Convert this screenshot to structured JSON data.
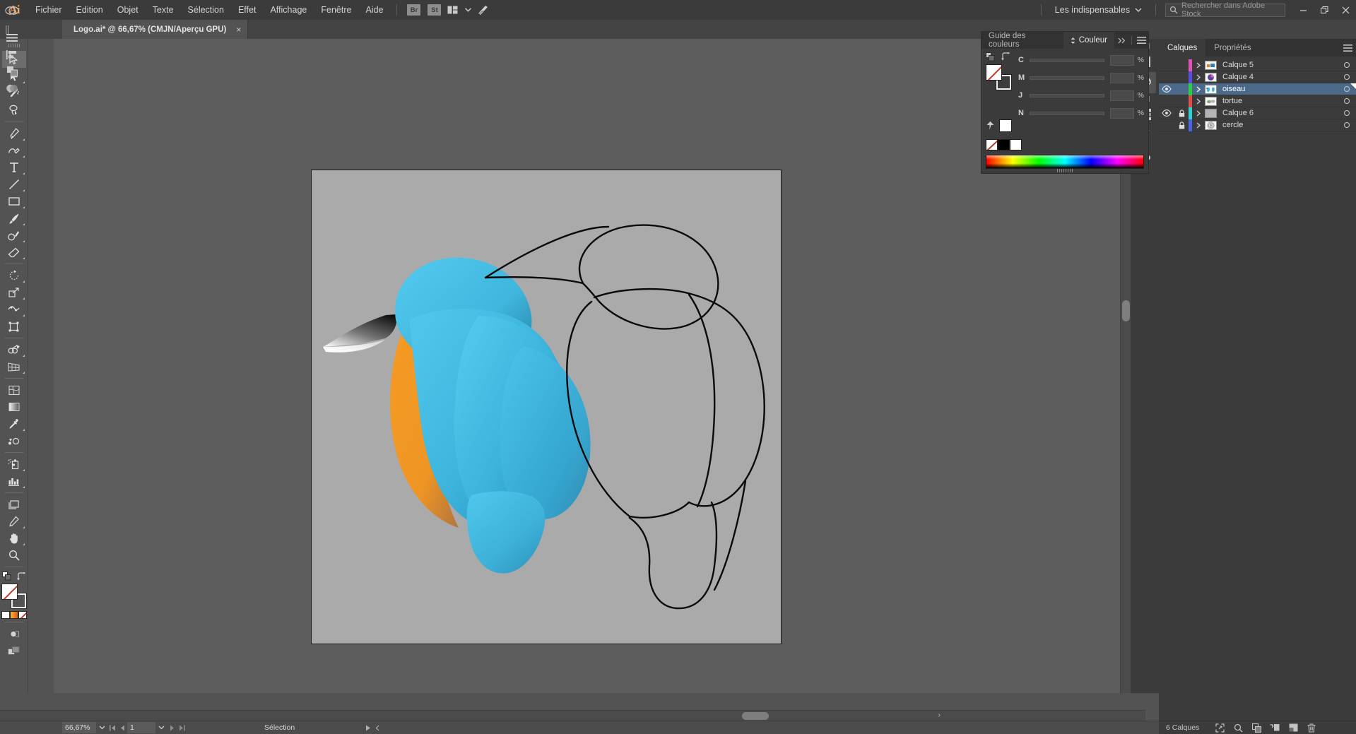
{
  "app": {
    "name": "Adobe Illustrator",
    "logo_text": "Ai"
  },
  "menubar": {
    "items": [
      "Fichier",
      "Edition",
      "Objet",
      "Texte",
      "Sélection",
      "Effet",
      "Affichage",
      "Fenêtre",
      "Aide"
    ],
    "chips": [
      "Br",
      "St"
    ],
    "arrange_icon": "arrange-documents-icon",
    "caret_icon": "chevron-down-icon",
    "stock_icon": "adobe-stock-icon",
    "workspace": {
      "label": "Les indispensables",
      "caret": "chevron-down-icon"
    },
    "search": {
      "placeholder": "Rechercher dans Adobe Stock",
      "icon": "search-icon"
    },
    "window_controls": {
      "minimize": "minimize-icon",
      "restore": "restore-icon",
      "close": "close-icon"
    }
  },
  "tabbar": {
    "document": {
      "title": "Logo.ai* @ 66,67% (CMJN/Aperçu GPU)",
      "close": "×"
    }
  },
  "toolbar": {
    "tools": [
      {
        "name": "selection-tool",
        "label": "Sélection",
        "active": true,
        "corner": false
      },
      {
        "name": "direct-selection-tool",
        "label": "Sélection directe",
        "active": false,
        "corner": true
      },
      {
        "name": "magic-wand-tool",
        "label": "Baguette magique",
        "active": false,
        "corner": false
      },
      {
        "name": "lasso-tool",
        "label": "Lasso",
        "active": false,
        "corner": false
      },
      {
        "name": "pen-tool",
        "label": "Plume",
        "active": false,
        "corner": true
      },
      {
        "name": "curvature-tool",
        "label": "Courbure",
        "active": false,
        "corner": true
      },
      {
        "name": "type-tool",
        "label": "Texte",
        "active": false,
        "corner": true
      },
      {
        "name": "line-segment-tool",
        "label": "Trait",
        "active": false,
        "corner": true
      },
      {
        "name": "rectangle-tool",
        "label": "Rectangle",
        "active": false,
        "corner": true
      },
      {
        "name": "paintbrush-tool",
        "label": "Pinceau",
        "active": false,
        "corner": true
      },
      {
        "name": "shaper-tool",
        "label": "Shaper",
        "active": false,
        "corner": true
      },
      {
        "name": "eraser-tool",
        "label": "Gomme",
        "active": false,
        "corner": true
      },
      {
        "name": "rotate-tool",
        "label": "Rotation",
        "active": false,
        "corner": true
      },
      {
        "name": "scale-tool",
        "label": "Mise à l'échelle",
        "active": false,
        "corner": true
      },
      {
        "name": "width-tool",
        "label": "Largeur",
        "active": false,
        "corner": true
      },
      {
        "name": "free-transform-tool",
        "label": "Transformation manuelle",
        "active": false,
        "corner": false
      },
      {
        "name": "shape-builder-tool",
        "label": "Concepteur de forme",
        "active": false,
        "corner": true
      },
      {
        "name": "perspective-grid-tool",
        "label": "Grille de perspective",
        "active": false,
        "corner": true
      },
      {
        "name": "mesh-tool",
        "label": "Filet",
        "active": false,
        "corner": false
      },
      {
        "name": "gradient-tool",
        "label": "Dégradé",
        "active": false,
        "corner": false
      },
      {
        "name": "eyedropper-tool",
        "label": "Pipette",
        "active": false,
        "corner": true
      },
      {
        "name": "blend-tool",
        "label": "Dégradé de formes",
        "active": false,
        "corner": false
      },
      {
        "name": "symbol-sprayer-tool",
        "label": "Pulvérisation de symboles",
        "active": false,
        "corner": true
      },
      {
        "name": "column-graph-tool",
        "label": "Graphe",
        "active": false,
        "corner": true
      },
      {
        "name": "artboard-tool",
        "label": "Plan de travail",
        "active": false,
        "corner": false
      },
      {
        "name": "slice-tool",
        "label": "Tranche",
        "active": false,
        "corner": true
      },
      {
        "name": "hand-tool",
        "label": "Main",
        "active": false,
        "corner": true
      },
      {
        "name": "zoom-tool",
        "label": "Zoom",
        "active": false,
        "corner": false
      }
    ],
    "fill_stroke": {
      "fill": "none",
      "stroke": "#ffffff",
      "swap_icon": "swap-fill-stroke-icon",
      "default_icon": "default-fill-stroke-icon"
    },
    "mini_swatches": [
      "#ffffff",
      "#f39c12",
      "none"
    ],
    "bottom_icons": [
      "draw-mode-icon",
      "screen-mode-icon"
    ]
  },
  "toolbar_second": {
    "icons": [
      "creative-cloud-icon",
      "properties-panel-icon",
      "align-panel-icon",
      "pathfinder-icon",
      "transparency-icon"
    ]
  },
  "color_panel": {
    "tabs": [
      {
        "label": "Guide des couleurs",
        "active": false
      },
      {
        "label": "Couleur",
        "active": true
      }
    ],
    "collapse_icon": "double-chevron-right-icon",
    "menu_icon": "panel-menu-icon",
    "channels": [
      {
        "label": "C",
        "value": "",
        "unit": "%"
      },
      {
        "label": "M",
        "value": "",
        "unit": "%"
      },
      {
        "label": "J",
        "value": "",
        "unit": "%"
      },
      {
        "label": "N",
        "value": "",
        "unit": "%"
      }
    ],
    "swatches": [
      "none",
      "#000000",
      "#ffffff"
    ],
    "spectrum": "cmyk-spectrum-ramp"
  },
  "layers_panel": {
    "tabs": [
      {
        "label": "Calques",
        "active": true
      },
      {
        "label": "Propriétés",
        "active": false
      }
    ],
    "menu_icon": "panel-menu-icon",
    "layers": [
      {
        "name": "Calque 5",
        "visible": false,
        "locked": false,
        "selected": false,
        "color": "#e052b8",
        "thumb": "layer-thumb-calque5"
      },
      {
        "name": "Calque 4",
        "visible": false,
        "locked": false,
        "selected": false,
        "color": "#5b4ce0",
        "thumb": "layer-thumb-calque4"
      },
      {
        "name": "oiseau",
        "visible": true,
        "locked": false,
        "selected": true,
        "color": "#2ecc40",
        "thumb": "layer-thumb-oiseau"
      },
      {
        "name": "tortue",
        "visible": false,
        "locked": false,
        "selected": false,
        "color": "#e04b4b",
        "thumb": "layer-thumb-tortue"
      },
      {
        "name": "Calque 6",
        "visible": true,
        "locked": true,
        "selected": false,
        "color": "#2bd3d3",
        "thumb": "layer-thumb-calque6"
      },
      {
        "name": "cercle",
        "visible": false,
        "locked": true,
        "selected": false,
        "color": "#4a63e0",
        "thumb": "layer-thumb-cercle"
      }
    ],
    "footer": {
      "count": "6 Calques",
      "icons": [
        "locate-object-icon",
        "search-layer-icon",
        "make-clipping-mask-icon",
        "create-sublayer-icon",
        "new-layer-icon",
        "delete-layer-icon"
      ]
    }
  },
  "right_dock": {
    "groups": [
      [
        "color-guide-icon",
        "color-panel-icon"
      ],
      [
        "swatches-icon",
        "brushes-icon",
        "symbols-icon"
      ]
    ]
  },
  "statusbar": {
    "zoom": "66,67%",
    "zoom_caret": "chevron-down-icon",
    "first_page_icon": "first-artboard-icon",
    "prev_page_icon": "prev-artboard-icon",
    "page": "1",
    "page_caret": "chevron-down-icon",
    "next_page_icon": "next-artboard-icon",
    "last_page_icon": "last-artboard-icon",
    "status_text": "Sélection",
    "play_icon": "play-icon",
    "back_icon": "chevron-left-icon"
  },
  "canvas": {
    "artboard_background": "#aaaaaa",
    "canvas_background": "#5d5d5d",
    "artwork": {
      "filled_bird": {
        "name": "kingfisher-filled",
        "colors": {
          "body_light": "#4cc3e8",
          "body_mid": "#39b5dd",
          "body_dark": "#2b93bb",
          "belly_orange": "#f0962a",
          "belly_shadow": "#a9703a",
          "beak_dark": "#1c1c1c",
          "beak_light": "#f2f2f2"
        }
      },
      "outline_bird": {
        "name": "kingfisher-outline",
        "stroke": "#000000",
        "stroke_width": 2.2
      }
    }
  }
}
